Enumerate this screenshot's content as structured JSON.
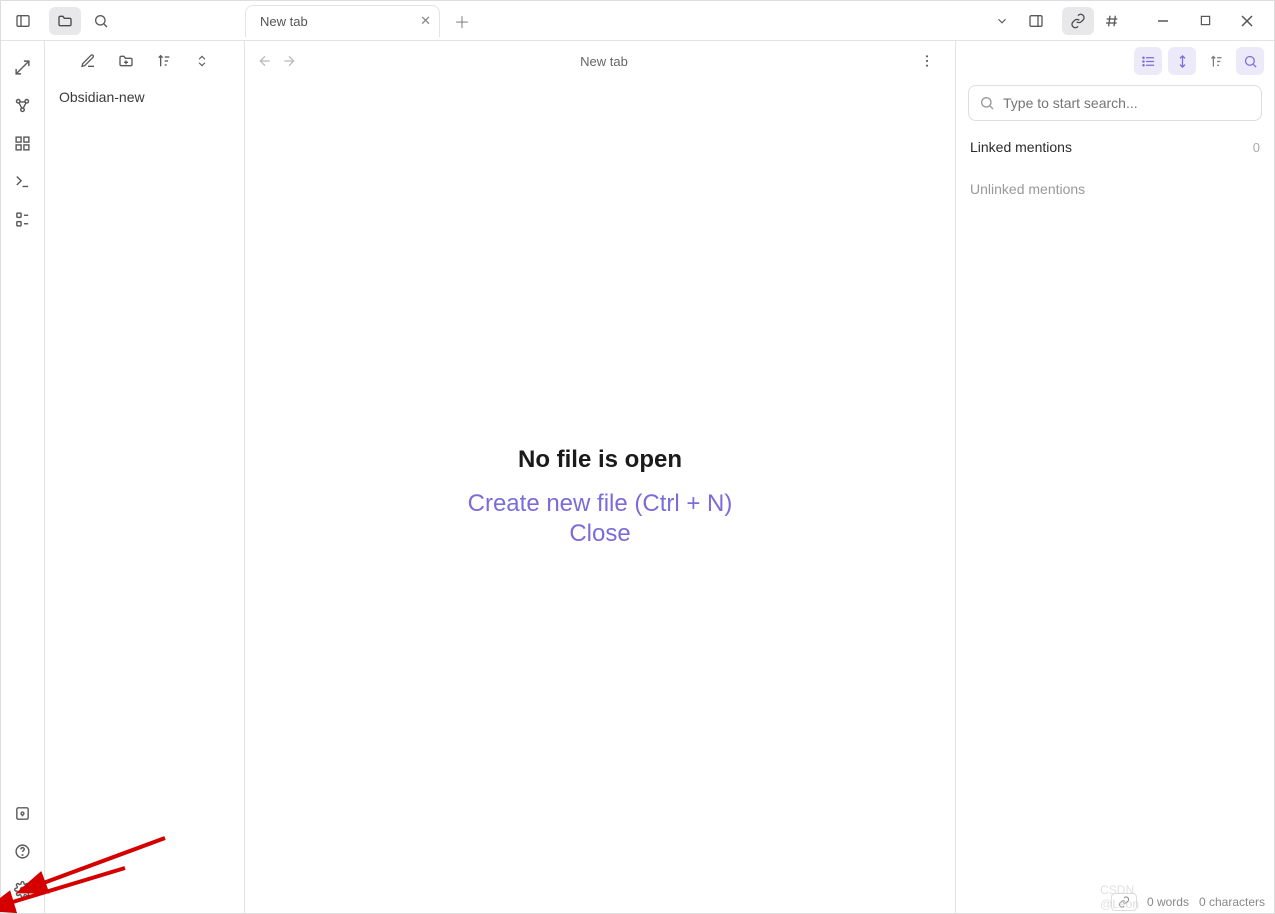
{
  "top": {
    "tab_label": "New tab"
  },
  "file_panel": {
    "vault_name": "Obsidian-new"
  },
  "editor": {
    "header_title": "New tab",
    "empty_title": "No file is open",
    "create_label": "Create new file (Ctrl + N)",
    "close_label": "Close"
  },
  "right": {
    "search_placeholder": "Type to start search...",
    "linked_label": "Linked mentions",
    "linked_count": "0",
    "unlinked_label": "Unlinked mentions"
  },
  "status": {
    "words": "0 words",
    "chars": "0 characters"
  },
  "watermark": "CSDN @Leon"
}
